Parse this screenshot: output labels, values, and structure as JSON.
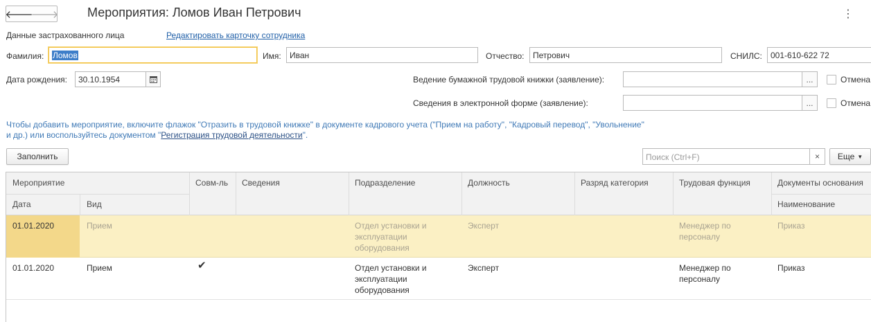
{
  "window": {
    "title": "Мероприятия: Ломов Иван Петрович",
    "back_icon": "arrow-left-icon",
    "forward_icon": "arrow-right-icon",
    "more_glyph": "⋮",
    "close_glyph": "×"
  },
  "insured": {
    "section_label": "Данные застрахованного лица",
    "edit_link": "Редактировать карточку сотрудника"
  },
  "fields": {
    "last_name_label": "Фамилия:",
    "last_name_value": "Ломов",
    "first_name_label": "Имя:",
    "first_name_value": "Иван",
    "middle_name_label": "Отчество:",
    "middle_name_value": "Петрович",
    "snils_label": "СНИЛС:",
    "snils_value": "001-610-622 72",
    "birth_date_label": "Дата рождения:",
    "birth_date_value": "30.10.1954",
    "paper_book_label": "Ведение бумажной трудовой книжки (заявление):",
    "paper_book_value": "",
    "paper_book_cancel": "Отмена",
    "electronic_label": "Сведения в электронной форме (заявление):",
    "electronic_value": "",
    "electronic_cancel": "Отмена",
    "picker_glyph": "..."
  },
  "info": {
    "line1": "Чтобы добавить мероприятие, включите флажок \"Отразить в трудовой книжке\" в документе кадрового учета (\"Прием на работу\", \"Кадровый перевод\", \"Увольнение\"",
    "line2_pre": "и др.) или воспользуйтесь документом \"",
    "line2_link": "Регистрация трудовой деятельности",
    "line2_post": "\"."
  },
  "toolbar": {
    "fill_label": "Заполнить",
    "search_placeholder": "Поиск (Ctrl+F)",
    "clear_glyph": "×",
    "more_label": "Еще"
  },
  "table": {
    "headers": {
      "event": "Мероприятие",
      "date": "Дата",
      "kind": "Вид",
      "combined": "Совм-ль",
      "info": "Сведения",
      "department": "Подразделение",
      "position": "Должность",
      "grade": "Разряд категория",
      "function": "Трудовая функция",
      "basis_docs": "Документы основания",
      "basis_name": "Наименование"
    },
    "rows": [
      {
        "date": "01.01.2020",
        "kind": "Прием",
        "combined": "",
        "info": "",
        "department": [
          "Отдел установки и",
          "эксплуатации",
          "оборудования"
        ],
        "position": "Эксперт",
        "grade": "",
        "function": [
          "Менеджер по",
          "персоналу"
        ],
        "basis_name": "Приказ"
      },
      {
        "date": "01.01.2020",
        "kind": "Прием",
        "combined": "✔",
        "info": "",
        "department": [
          "Отдел установки и",
          "эксплуатации",
          "оборудования"
        ],
        "position": "Эксперт",
        "grade": "",
        "function": [
          "Менеджер по",
          "персоналу"
        ],
        "basis_name": "Приказ"
      }
    ]
  }
}
